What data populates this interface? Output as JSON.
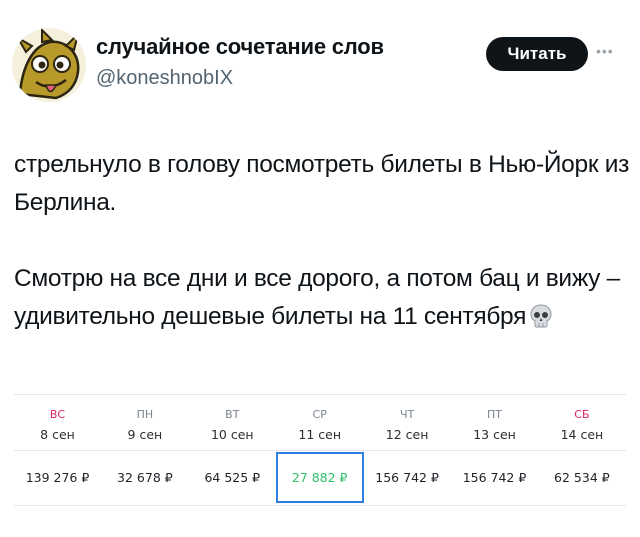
{
  "author": {
    "display_name": "случайное сочетание слов",
    "handle": "@koneshnobIX",
    "avatar_icon": "dragon-avatar-icon"
  },
  "actions": {
    "follow_label": "Читать",
    "more_icon": "more-dots-icon"
  },
  "tweet": {
    "paragraph_1": "стрельнуло в голову посмотреть билеты в Нью-Йорк из Берлина.",
    "paragraph_2": "Смотрю на все дни и все дорого, а потом бац и вижу – удивительно дешевые билеты на 11 сентября",
    "emoji_icon": "skull-icon"
  },
  "calendar": {
    "days": [
      {
        "dow": "ВС",
        "date": "8 сен",
        "price": "139 276 ₽",
        "weekend": true,
        "selected": false
      },
      {
        "dow": "ПН",
        "date": "9 сен",
        "price": "32 678 ₽",
        "weekend": false,
        "selected": false
      },
      {
        "dow": "ВТ",
        "date": "10 сен",
        "price": "64 525 ₽",
        "weekend": false,
        "selected": false
      },
      {
        "dow": "СР",
        "date": "11 сен",
        "price": "27 882 ₽",
        "weekend": false,
        "selected": true
      },
      {
        "dow": "ЧТ",
        "date": "12 сен",
        "price": "156 742 ₽",
        "weekend": false,
        "selected": false
      },
      {
        "dow": "ПТ",
        "date": "13 сен",
        "price": "156 742 ₽",
        "weekend": false,
        "selected": false
      },
      {
        "dow": "СБ",
        "date": "14 сен",
        "price": "62 534 ₽",
        "weekend": true,
        "selected": false
      }
    ],
    "colors": {
      "weekend": "#e0245e",
      "cheapest": "#2ec26a",
      "selected_border": "#2f7de1"
    }
  }
}
